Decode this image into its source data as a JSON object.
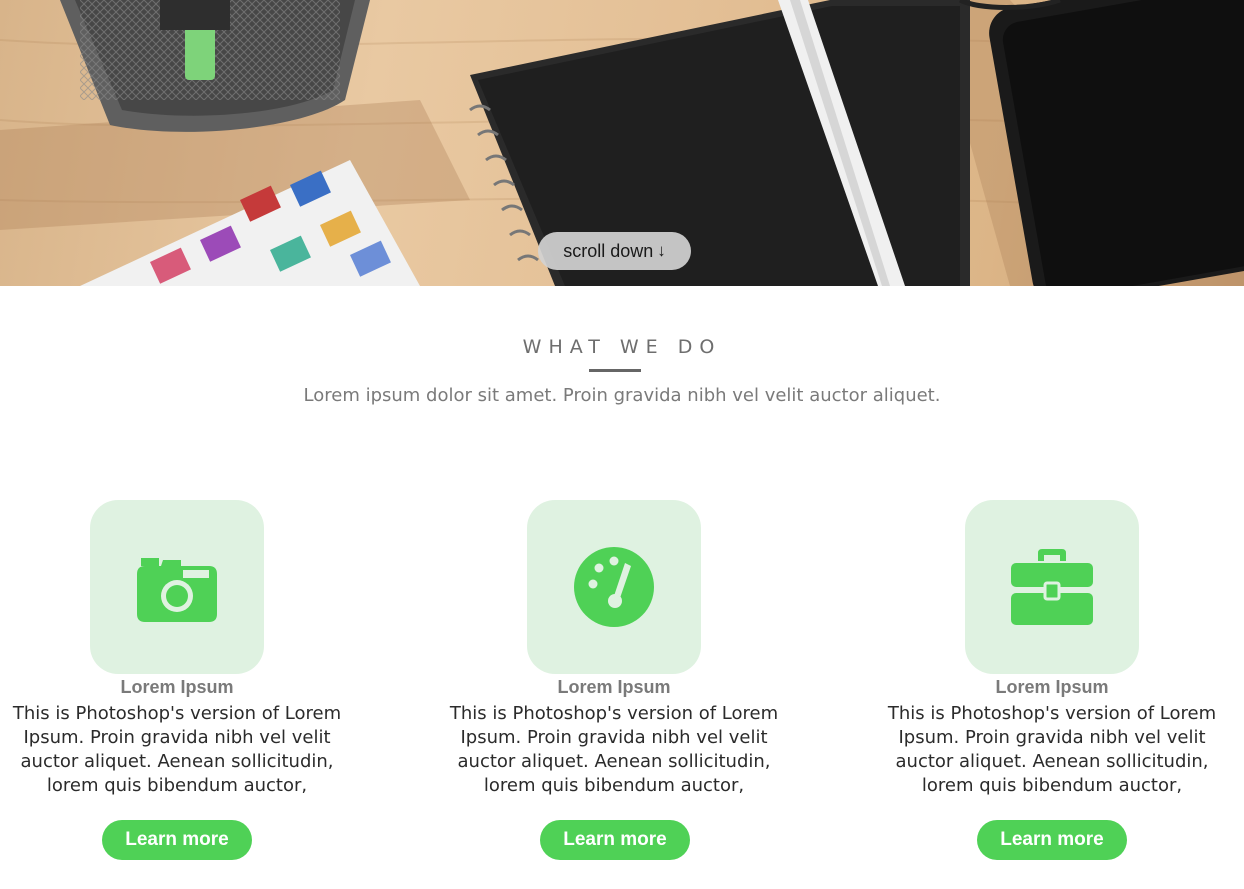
{
  "colors": {
    "accent": "#4fd156",
    "icon_bg": "#dff2e1",
    "title_gray": "#6e6e6e",
    "text_dark": "#2b2b2b"
  },
  "hero": {
    "scroll_label": "scroll down",
    "scroll_arrow": "↓"
  },
  "section": {
    "title": "WHAT WE DO",
    "subtitle": "Lorem ipsum dolor sit amet. Proin gravida nibh vel velit auctor aliquet."
  },
  "cards": [
    {
      "icon": "camera-icon",
      "title": "Lorem Ipsum",
      "text": "This is Photoshop's version of Lorem Ipsum. Proin gravida nibh vel velit auctor aliquet. Aenean sollicitudin, lorem quis bibendum auctor,",
      "button": "Learn more"
    },
    {
      "icon": "dashboard-icon",
      "title": "Lorem Ipsum",
      "text": "This is Photoshop's version of Lorem Ipsum. Proin gravida nibh vel velit auctor aliquet. Aenean sollicitudin, lorem quis bibendum auctor,",
      "button": "Learn more"
    },
    {
      "icon": "briefcase-icon",
      "title": "Lorem Ipsum",
      "text": "This is Photoshop's version of Lorem Ipsum. Proin gravida nibh vel velit auctor aliquet. Aenean sollicitudin, lorem quis bibendum auctor,",
      "button": "Learn more"
    }
  ]
}
